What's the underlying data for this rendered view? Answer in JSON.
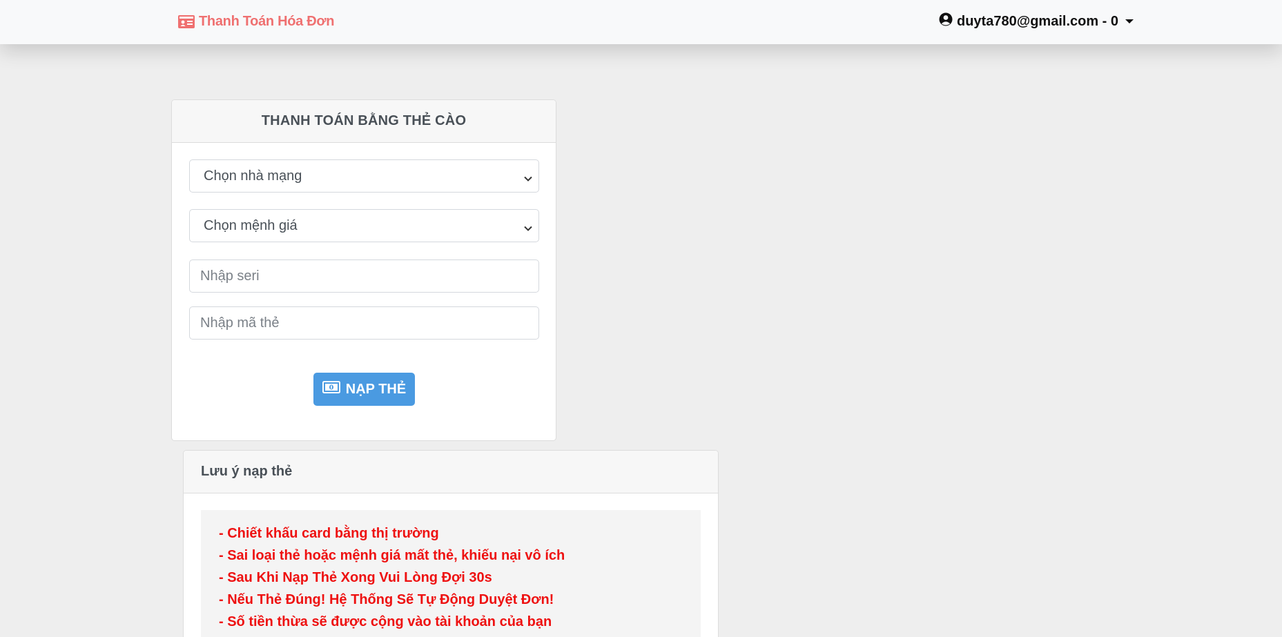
{
  "navbar": {
    "brand_label": "Thanh Toán Hóa Đơn",
    "brand_icon": "id-card-icon",
    "user_label": "duyta780@gmail.com - 0",
    "user_icon": "user-circle-icon",
    "brand_color": "#ef7070"
  },
  "payment_card": {
    "title": "THANH TOÁN BẰNG THẺ CÀO",
    "network_select": {
      "selected": "Chọn nhà mạng"
    },
    "value_select": {
      "selected": "Chọn mệnh giá"
    },
    "serial_input": {
      "placeholder": "Nhập seri",
      "value": ""
    },
    "code_input": {
      "placeholder": "Nhập mã thẻ",
      "value": ""
    },
    "submit_label": "NẠP THẺ",
    "submit_icon": "money-bill-icon",
    "accent_color": "#4a9ae1"
  },
  "notes_card": {
    "title": "Lưu ý nạp thẻ",
    "lines": [
      "- Chiết khấu card bằng thị trường",
      "- Sai loại thẻ hoặc mệnh giá mất thẻ, khiếu nại vô ích",
      "- Sau Khi Nạp Thẻ Xong Vui Lòng Đợi 30s",
      "- Nếu Thẻ Đúng! Hệ Thống Sẽ Tự Động Duyệt Đơn!",
      "- Số tiền thừa sẽ được cộng vào tài khoản của bạn"
    ],
    "text_color": "#ee1111"
  }
}
